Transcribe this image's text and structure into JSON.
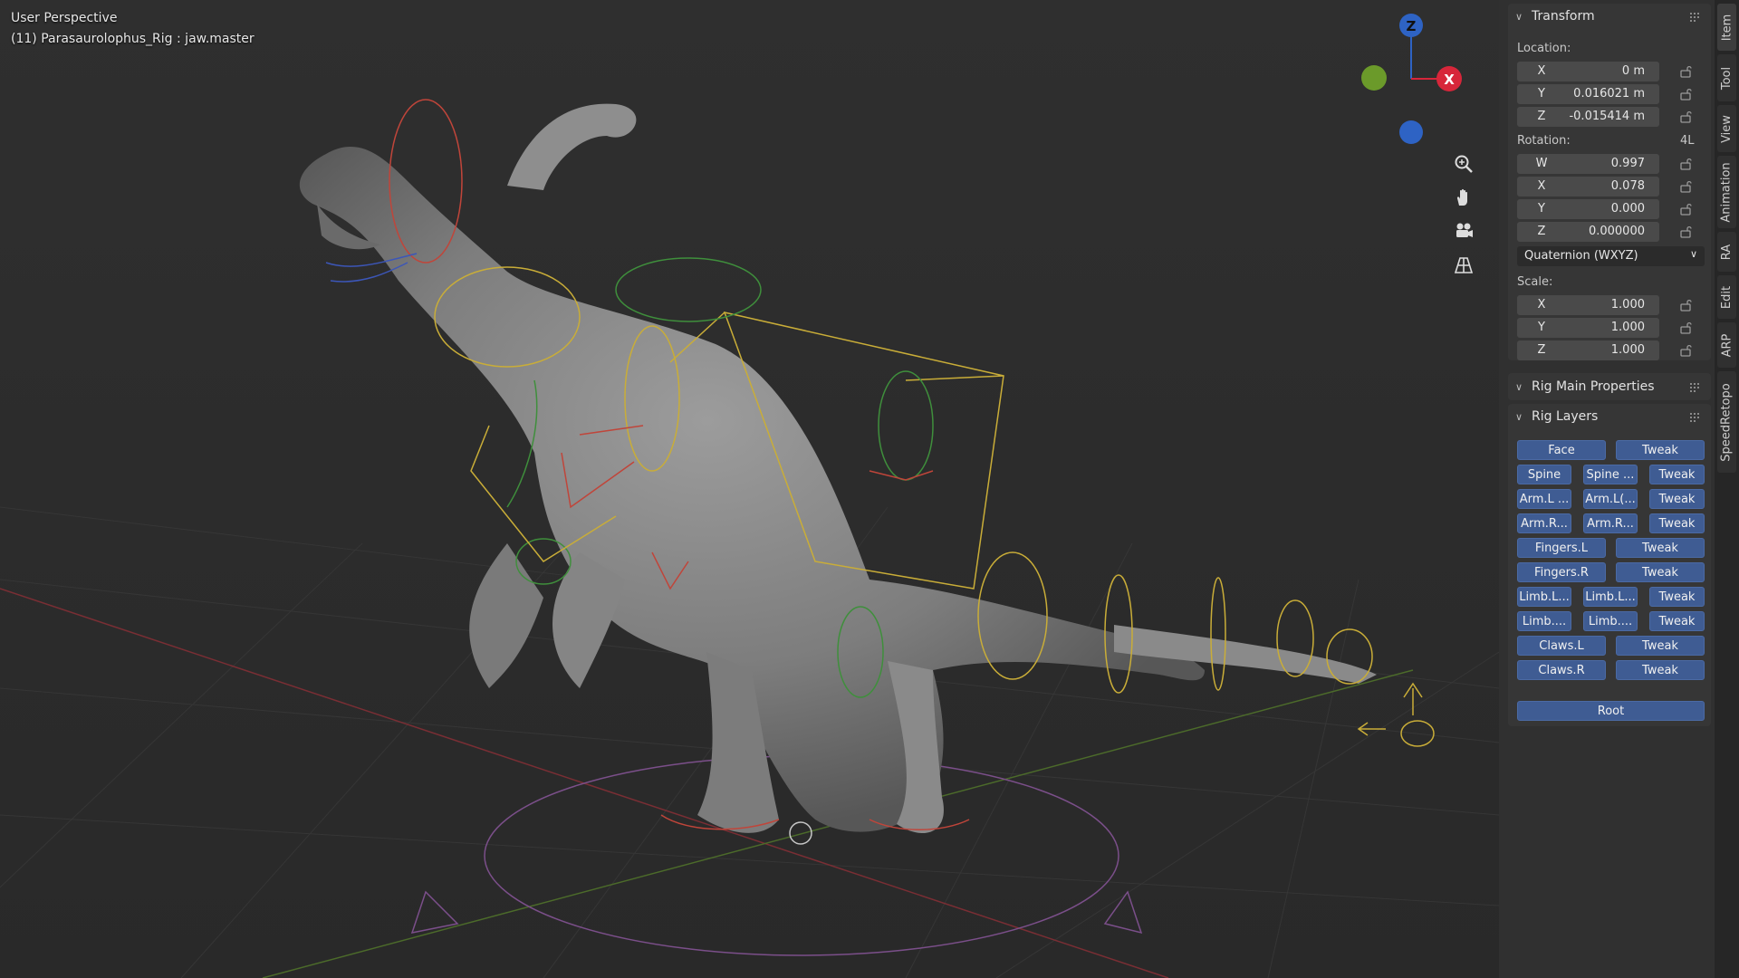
{
  "viewport": {
    "perspective_label": "User Perspective",
    "object_label": "(11) Parasaurolophus_Rig : jaw.master",
    "gizmo": {
      "z_label": "Z",
      "x_label": "X"
    },
    "nav_icons": [
      "zoom-icon",
      "hand-pan-icon",
      "camera-icon",
      "grid-perspective-icon"
    ],
    "colors": {
      "z_axis": "#2e63c4",
      "x_axis": "#d7263a",
      "y_axis": "#6b9a2a",
      "rig_yellow": "#d2b63a",
      "rig_red": "#c0453a",
      "rig_green": "#3f8f3c",
      "rig_blue": "#3c56b8"
    }
  },
  "transform": {
    "title": "Transform",
    "location_label": "Location:",
    "location": [
      {
        "axis": "X",
        "value": "0 m"
      },
      {
        "axis": "Y",
        "value": "0.016021 m"
      },
      {
        "axis": "Z",
        "value": "-0.015414 m"
      }
    ],
    "rotation_label": "Rotation:",
    "rotation_extra": "4L",
    "rotation": [
      {
        "axis": "W",
        "value": "0.997"
      },
      {
        "axis": "X",
        "value": "0.078"
      },
      {
        "axis": "Y",
        "value": "0.000"
      },
      {
        "axis": "Z",
        "value": "0.000000"
      }
    ],
    "rotation_mode": "Quaternion (WXYZ)",
    "scale_label": "Scale:",
    "scale": [
      {
        "axis": "X",
        "value": "1.000"
      },
      {
        "axis": "Y",
        "value": "1.000"
      },
      {
        "axis": "Z",
        "value": "1.000"
      }
    ]
  },
  "rig_main": {
    "title": "Rig Main Properties"
  },
  "rig_layers": {
    "title": "Rig Layers",
    "rows": [
      [
        "Face",
        "Tweak"
      ],
      [
        "Spine",
        "Spine ...",
        "Tweak"
      ],
      [
        "Arm.L ...",
        "Arm.L(...",
        "Tweak"
      ],
      [
        "Arm.R...",
        "Arm.R...",
        "Tweak"
      ],
      [
        "Fingers.L",
        "Tweak"
      ],
      [
        "Fingers.R",
        "Tweak"
      ],
      [
        "Limb.L...",
        "Limb.L...",
        "Tweak"
      ],
      [
        "Limb....",
        "Limb....",
        "Tweak"
      ],
      [
        "Claws.L",
        "Tweak"
      ],
      [
        "Claws.R",
        "Tweak"
      ]
    ],
    "root": "Root"
  },
  "tabs": [
    "Item",
    "Tool",
    "View",
    "Animation",
    "RA",
    "Edit",
    "ARP",
    "SpeedRetopo"
  ]
}
